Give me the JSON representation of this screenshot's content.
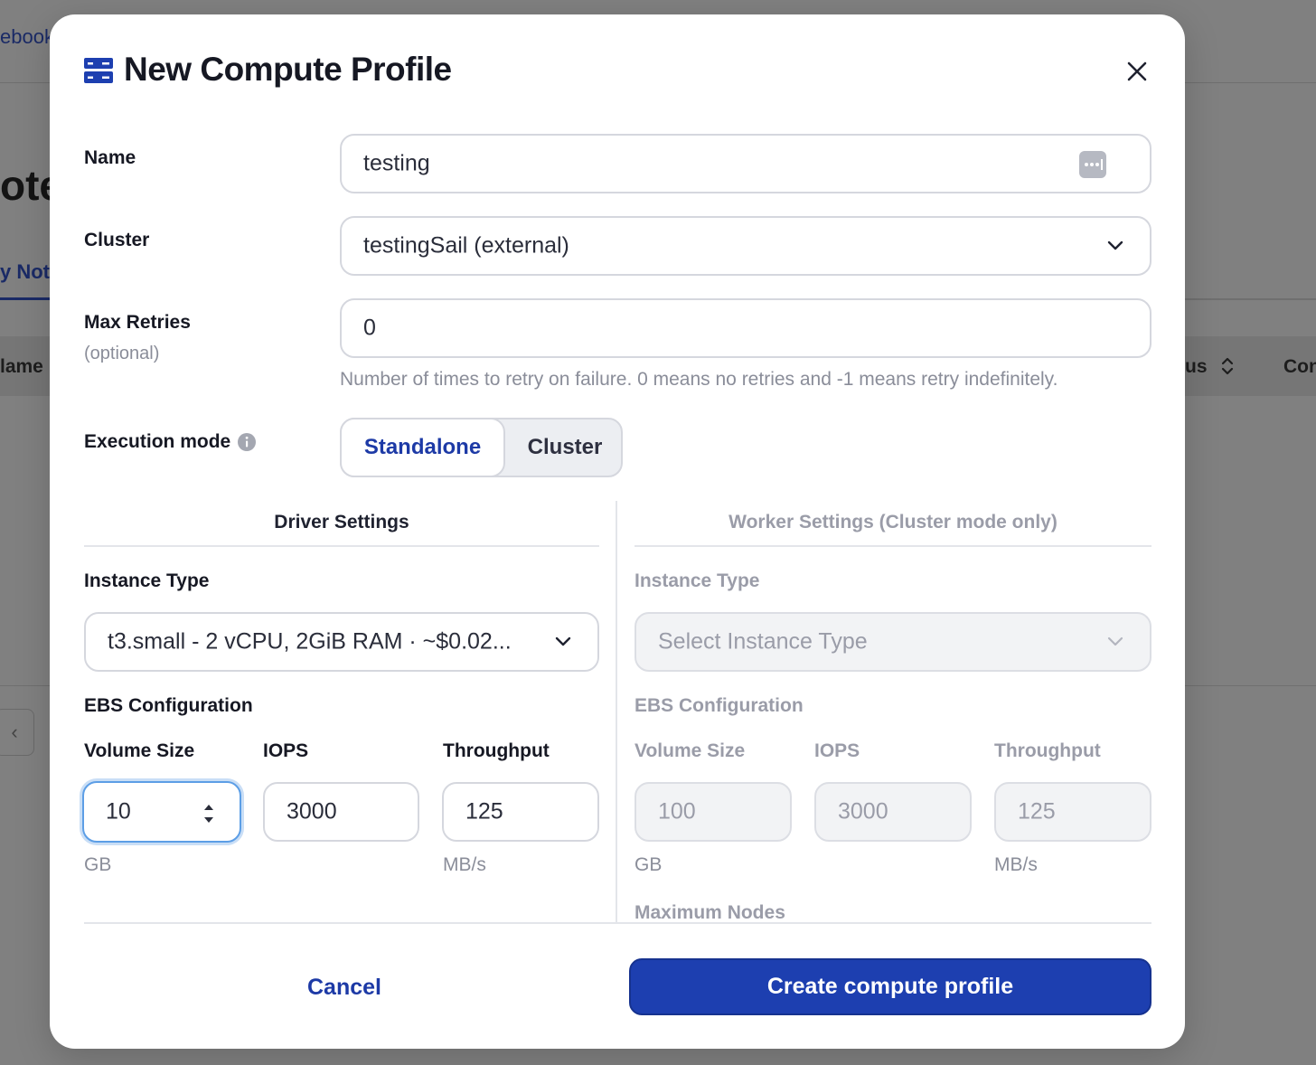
{
  "background": {
    "link_fragment": "ebook",
    "title_fragment": "ote",
    "tab_fragment": "y Not",
    "table_headers": [
      "lame",
      "us",
      "Con"
    ]
  },
  "modal": {
    "title": "New Compute Profile",
    "name": {
      "label": "Name",
      "value": "testing"
    },
    "cluster": {
      "label": "Cluster",
      "value": "testingSail (external)"
    },
    "max_retries": {
      "label": "Max Retries",
      "sublabel": "(optional)",
      "value": "0",
      "help": "Number of times to retry on failure. 0 means no retries and -1 means retry indefinitely."
    },
    "execution_mode": {
      "label": "Execution mode",
      "options": [
        "Standalone",
        "Cluster"
      ],
      "selected": "Standalone"
    },
    "driver": {
      "heading": "Driver Settings",
      "instance_type_label": "Instance Type",
      "instance_type_value": "t3.small - 2 vCPU, 2GiB RAM · ~$0.02...",
      "ebs_label": "EBS Configuration",
      "volume_size": {
        "label": "Volume Size",
        "value": "10",
        "unit": "GB"
      },
      "iops": {
        "label": "IOPS",
        "value": "3000"
      },
      "throughput": {
        "label": "Throughput",
        "value": "125",
        "unit": "MB/s"
      }
    },
    "worker": {
      "heading": "Worker Settings (Cluster mode only)",
      "instance_type_label": "Instance Type",
      "instance_type_placeholder": "Select Instance Type",
      "ebs_label": "EBS Configuration",
      "volume_size": {
        "label": "Volume Size",
        "value": "100",
        "unit": "GB"
      },
      "iops": {
        "label": "IOPS",
        "value": "3000"
      },
      "throughput": {
        "label": "Throughput",
        "value": "125",
        "unit": "MB/s"
      },
      "max_nodes_label": "Maximum Nodes"
    },
    "actions": {
      "cancel": "Cancel",
      "create": "Create compute profile"
    }
  },
  "colors": {
    "accent": "#1d3fb0",
    "link": "#1d3aa6",
    "focus": "#5c9ee6"
  }
}
